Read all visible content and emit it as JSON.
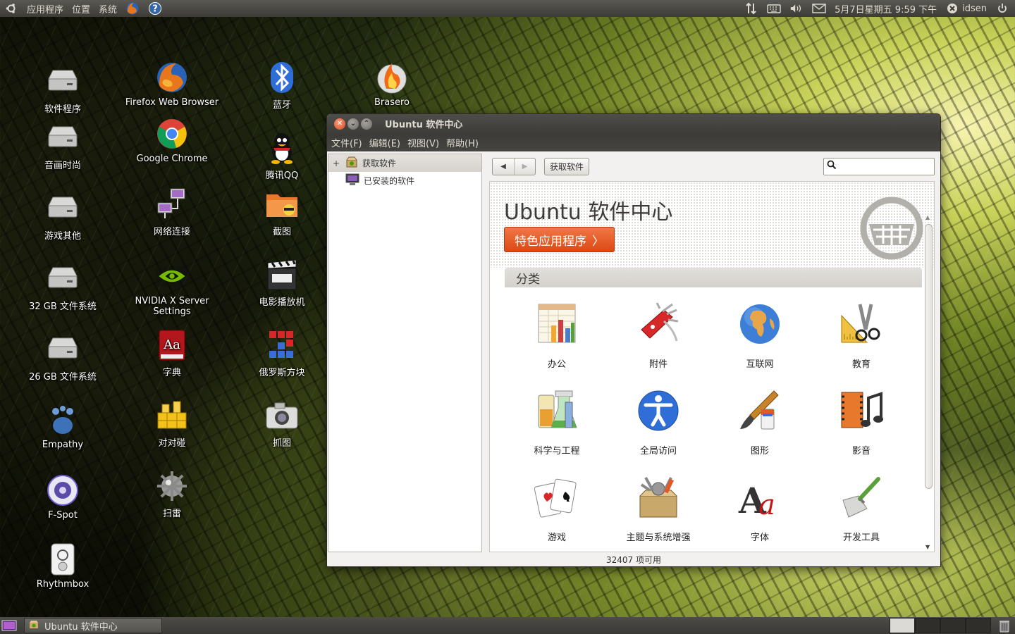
{
  "top_panel": {
    "menus": [
      "应用程序",
      "位置",
      "系统"
    ],
    "datetime": "5月7日星期五  9:59 下午",
    "user": "idsen"
  },
  "desktop_icons": [
    {
      "label": "软件程序",
      "icon": "drive-icon"
    },
    {
      "label": "音画时尚",
      "icon": "drive-icon"
    },
    {
      "label": "游戏其他",
      "icon": "drive-icon"
    },
    {
      "label": "32 GB 文件系统",
      "icon": "drive-icon"
    },
    {
      "label": "26 GB 文件系统",
      "icon": "drive-icon"
    },
    {
      "label": "Empathy",
      "icon": "empathy-icon"
    },
    {
      "label": "F-Spot",
      "icon": "fspot-icon"
    },
    {
      "label": "Rhythmbox",
      "icon": "rhythmbox-icon"
    },
    {
      "label": "Firefox Web Browser",
      "icon": "firefox-icon"
    },
    {
      "label": "Google Chrome",
      "icon": "chrome-icon"
    },
    {
      "label": "网络连接",
      "icon": "network-icon"
    },
    {
      "label": "NVIDIA X Server Settings",
      "icon": "nvidia-icon"
    },
    {
      "label": "字典",
      "icon": "dictionary-icon"
    },
    {
      "label": "对对碰",
      "icon": "puzzle-icon"
    },
    {
      "label": "扫雷",
      "icon": "mines-icon"
    },
    {
      "label": "蓝牙",
      "icon": "bluetooth-icon"
    },
    {
      "label": "腾讯QQ",
      "icon": "qq-icon"
    },
    {
      "label": "截图",
      "icon": "screenshot-folder-icon"
    },
    {
      "label": "电影播放机",
      "icon": "movie-icon"
    },
    {
      "label": "俄罗斯方块",
      "icon": "tetris-icon"
    },
    {
      "label": "抓图",
      "icon": "camera-icon"
    },
    {
      "label": "Brasero",
      "icon": "brasero-icon"
    }
  ],
  "window": {
    "title": "Ubuntu 软件中心",
    "menus": [
      "文件(F)",
      "编辑(E)",
      "视图(V)",
      "帮助(H)"
    ],
    "sidebar": [
      {
        "label": "获取软件",
        "expander": "+",
        "selected": true
      },
      {
        "label": "已安装的软件",
        "expander": "",
        "selected": false
      }
    ],
    "breadcrumb": "获取软件",
    "search_placeholder": "",
    "hero_title": "Ubuntu 软件中心",
    "featured_label": "特色应用程序",
    "categories_header": "分类",
    "categories": [
      {
        "label": "办公",
        "icon": "office-icon"
      },
      {
        "label": "附件",
        "icon": "accessories-icon"
      },
      {
        "label": "互联网",
        "icon": "internet-icon"
      },
      {
        "label": "教育",
        "icon": "education-icon"
      },
      {
        "label": "科学与工程",
        "icon": "science-icon"
      },
      {
        "label": "全局访问",
        "icon": "accessibility-icon"
      },
      {
        "label": "图形",
        "icon": "graphics-icon"
      },
      {
        "label": "影音",
        "icon": "multimedia-icon"
      },
      {
        "label": "游戏",
        "icon": "games-icon"
      },
      {
        "label": "主题与系统增强",
        "icon": "themes-icon"
      },
      {
        "label": "字体",
        "icon": "fonts-icon"
      },
      {
        "label": "开发工具",
        "icon": "developer-icon"
      }
    ],
    "status": "32407 项可用"
  },
  "taskbar": {
    "task_label": "Ubuntu 软件中心"
  },
  "colors": {
    "panel": "#3c3b37",
    "ubuntu_orange": "#dd4814",
    "window_bg": "#f2f1f0"
  }
}
